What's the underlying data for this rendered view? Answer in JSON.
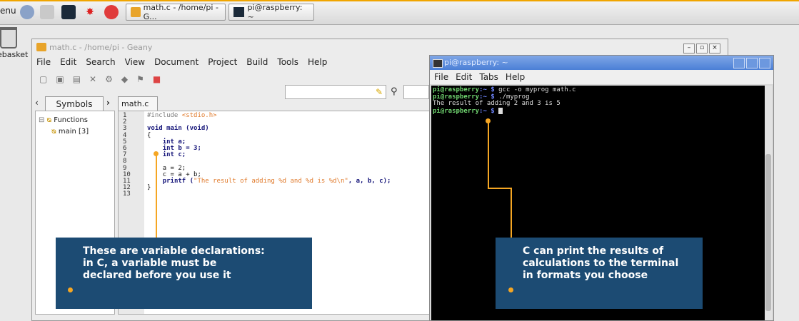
{
  "taskbar": {
    "menu_label": "enu",
    "tasks": [
      {
        "label": "math.c - /home/pi - G..."
      },
      {
        "label": "pi@raspberry: ~"
      }
    ]
  },
  "desktop": {
    "trash_label": "ebasket"
  },
  "geany": {
    "title": "math.c - /home/pi - Geany",
    "menu": [
      "File",
      "Edit",
      "Search",
      "View",
      "Document",
      "Project",
      "Build",
      "Tools",
      "Help"
    ],
    "sidebar_tab": "Symbols",
    "editor_tab": "math.c",
    "symbols": [
      {
        "label": "Functions"
      },
      {
        "label": "main [3]"
      }
    ],
    "line_numbers": [
      "1",
      "2",
      "3",
      "4",
      "5",
      "6",
      "7",
      "8",
      "9",
      "10",
      "11",
      "12",
      "13"
    ],
    "code": {
      "l1_pre": "#include ",
      "l1_hdr": "<stdio.h>",
      "l3": "void main (void)",
      "l4": "{",
      "l5": "int a;",
      "l6": "int b = 3;",
      "l7": "int c;",
      "l9": "a = 2;",
      "l10": "c = a + b;",
      "l11_a": "printf (",
      "l11_str": "\"The result of adding %d and %d is %d\\n\"",
      "l11_b": ", a, b, c);",
      "l12": "}"
    }
  },
  "terminal": {
    "title": "pi@raspberry: ~",
    "menu": [
      "File",
      "Edit",
      "Tabs",
      "Help"
    ],
    "lines": [
      {
        "user": "pi@raspberry",
        "path": ":~ $",
        "cmd": " gcc -o myprog math.c"
      },
      {
        "user": "pi@raspberry",
        "path": ":~ $",
        "cmd": " ./myprog"
      },
      {
        "output": "The result of adding 2 and 3 is 5"
      },
      {
        "user": "pi@raspberry",
        "path": ":~ $",
        "cmd": " "
      }
    ]
  },
  "callouts": {
    "left": "These are variable declarations:\nin C, a variable must be\ndeclared before you use it",
    "right": "C can print the results of\ncalculations to the terminal\nin formats you choose"
  },
  "colors": {
    "callout_bg": "#1c4b73",
    "leader": "#f5a623",
    "terminal_bg": "#000000",
    "prompt_green": "#6fd36f"
  }
}
